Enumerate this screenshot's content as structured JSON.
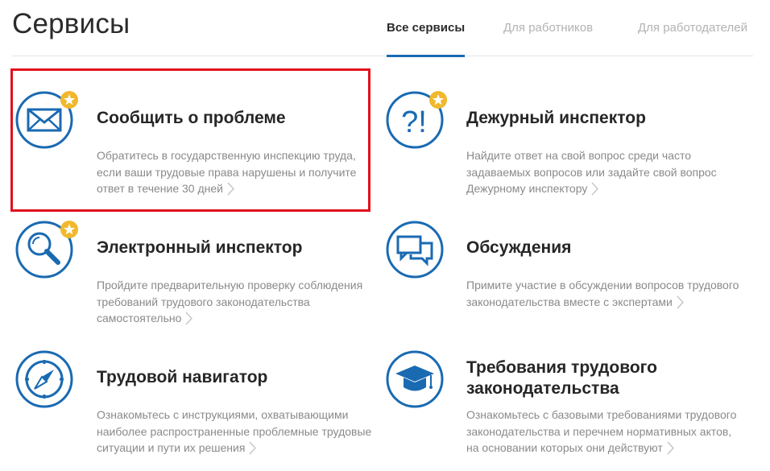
{
  "page_title": "Сервисы",
  "tabs": [
    {
      "label": "Все сервисы",
      "active": true
    },
    {
      "label": "Для работников",
      "active": false
    },
    {
      "label": "Для работодателей",
      "active": false
    }
  ],
  "colors": {
    "accent": "#1a6ab2",
    "star": "#f1b82d",
    "highlight": "#e0121b"
  },
  "services": [
    {
      "title": [
        "Сообщить о проблеме"
      ],
      "description": [
        "Обратитесь в государственную инспекцию труда,",
        "если ваши трудовые права нарушены и получите",
        "ответ в течение 30 дней"
      ],
      "icon": "envelope-icon",
      "featured": true,
      "highlighted": true
    },
    {
      "title": [
        "Дежурный инспектор"
      ],
      "description": [
        "Найдите ответ на свой вопрос среди часто",
        "задаваемых вопросов или задайте свой вопрос",
        "Дежурному инспектору"
      ],
      "icon": "question-exclamation-icon",
      "featured": true
    },
    {
      "title": [
        "Электронный инспектор"
      ],
      "description": [
        "Пройдите предварительную проверку соблюдения",
        "требований трудового законодательства",
        "самостоятельно"
      ],
      "icon": "magnifier-icon",
      "featured": true
    },
    {
      "title": [
        "Обсуждения"
      ],
      "description": [
        "Примите участие в обсуждении вопросов трудового",
        "законодательства вместе с экспертами"
      ],
      "icon": "chat-bubbles-icon",
      "featured": false
    },
    {
      "title": [
        "Трудовой навигатор"
      ],
      "description": [
        "Ознакомьтесь с инструкциями, охватывающими",
        "наиболее распространенные проблемные трудовые",
        "ситуации и пути их решения"
      ],
      "icon": "compass-icon",
      "featured": false
    },
    {
      "title": [
        "Требования трудового",
        "законодательства"
      ],
      "description": [
        "Ознакомьтесь с базовыми требованиями трудового",
        "законодательства и перечнем нормативных актов,",
        "на основании которых они действуют"
      ],
      "icon": "graduation-cap-icon",
      "featured": false
    }
  ]
}
